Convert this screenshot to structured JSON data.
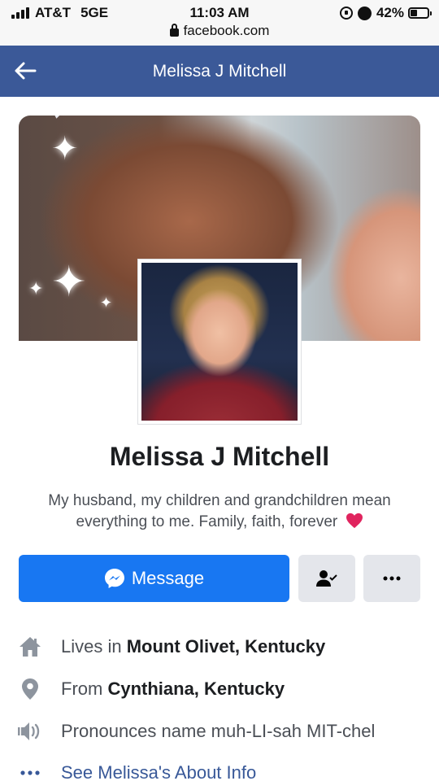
{
  "status_bar": {
    "carrier": "AT&T",
    "network": "5GE",
    "time": "11:03 AM",
    "battery_percent_label": "42%",
    "battery_level": 0.42,
    "url": "facebook.com"
  },
  "header": {
    "title": "Melissa J Mitchell"
  },
  "profile": {
    "name": "Melissa J Mitchell",
    "bio": "My husband, my children and grandchildren mean everything to me. Family, faith, forever"
  },
  "actions": {
    "message_label": "Message"
  },
  "info": {
    "lives_prefix": "Lives in ",
    "lives_value": "Mount Olivet, Kentucky",
    "from_prefix": "From ",
    "from_value": "Cynthiana, Kentucky",
    "pronounce_text": "Pronounces name muh-LI-sah MIT-chel",
    "about_link": "See Melissa's About Info"
  },
  "colors": {
    "header_blue": "#3b5998",
    "message_blue": "#1877f2",
    "link_blue": "#385898",
    "heart_red": "#e0245e"
  },
  "icons": [
    "signal-icon",
    "rotation-lock-icon",
    "alarm-icon",
    "battery-icon",
    "lock-icon",
    "back-arrow-icon",
    "heart-icon",
    "messenger-icon",
    "friend-check-icon",
    "more-icon",
    "home-icon",
    "location-pin-icon",
    "speaker-icon",
    "ellipsis-icon"
  ]
}
